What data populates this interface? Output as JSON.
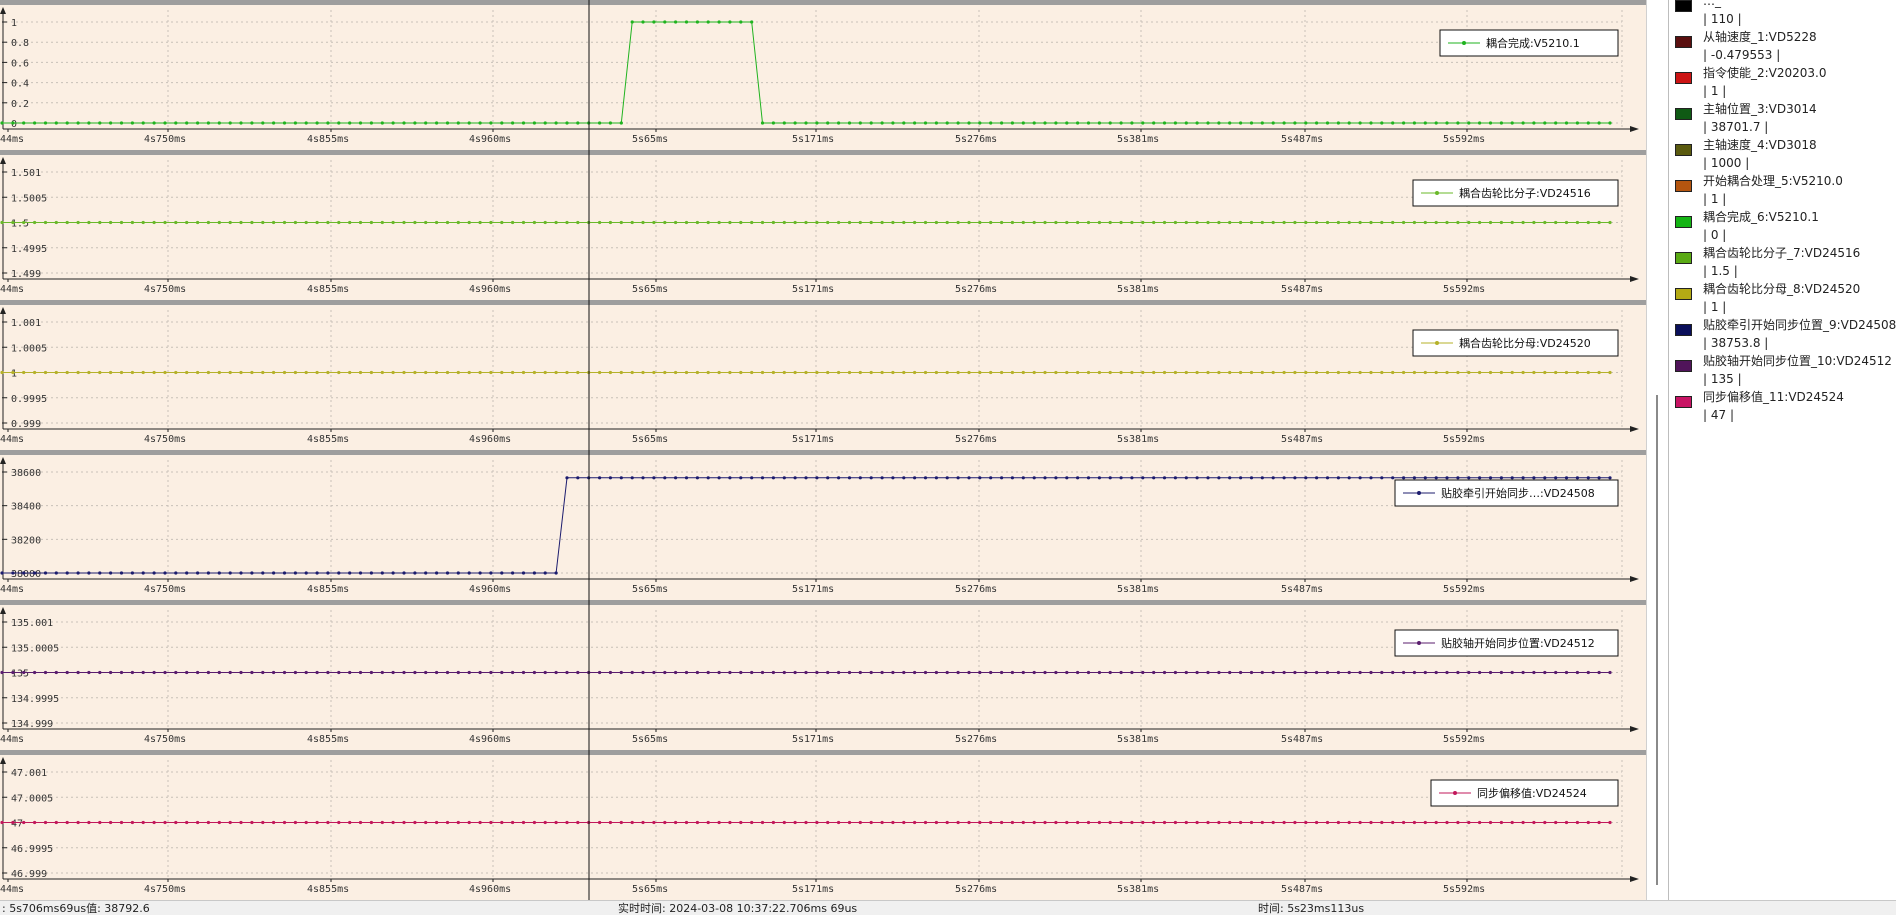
{
  "x_ticks": [
    "44ms",
    "4s750ms",
    "4s855ms",
    "4s960ms",
    "5s65ms",
    "5s171ms",
    "5s276ms",
    "5s381ms",
    "5s487ms",
    "5s592ms"
  ],
  "chart_data": [
    {
      "type": "line",
      "title": "",
      "series": [
        {
          "name": "耦合完成:V5210.1",
          "color": "#1fb31f"
        }
      ],
      "y_ticks": [
        "1",
        "0.8",
        "0.6",
        "0.4",
        "0.2",
        "0"
      ],
      "ylim": [
        0,
        1
      ],
      "steps": [
        {
          "from_point": 0,
          "to_point": 57,
          "y": 0
        },
        {
          "from_point": 58,
          "to_point": 69,
          "y": 1
        },
        {
          "from_point": 70,
          "to_point": 148,
          "y": 0
        }
      ],
      "points_count": 149,
      "grid": true,
      "legend_position": "top-right"
    },
    {
      "type": "line",
      "series": [
        {
          "name": "耦合齿轮比分子:VD24516",
          "color": "#6ab82a"
        }
      ],
      "y_ticks": [
        "1.501",
        "1.5005",
        "1.5",
        "1.4995",
        "1.499"
      ],
      "ylim": [
        1.499,
        1.501
      ],
      "constant_value": 1.5,
      "points_count": 149,
      "grid": true,
      "legend_position": "top-right"
    },
    {
      "type": "line",
      "series": [
        {
          "name": "耦合齿轮比分母:VD24520",
          "color": "#b5b12a"
        }
      ],
      "y_ticks": [
        "1.001",
        "1.0005",
        "1",
        "0.9995",
        "0.999"
      ],
      "ylim": [
        0.999,
        1.001
      ],
      "constant_value": 1,
      "points_count": 149,
      "grid": true,
      "legend_position": "top-right"
    },
    {
      "type": "line",
      "series": [
        {
          "name": "贴胶牵引开始同步…:VD24508",
          "color": "#1c1c6e"
        }
      ],
      "y_ticks": [
        "38600",
        "38400",
        "38200",
        "38000"
      ],
      "ylim": [
        38000,
        38800
      ],
      "steps": [
        {
          "from_point": 0,
          "to_point": 51,
          "y": 38000
        },
        {
          "from_point": 52,
          "to_point": 148,
          "y": 38753.8
        }
      ],
      "points_count": 149,
      "grid": true,
      "legend_position": "top-right"
    },
    {
      "type": "line",
      "series": [
        {
          "name": "贴胶轴开始同步位置:VD24512",
          "color": "#5a1d6e"
        }
      ],
      "y_ticks": [
        "135.001",
        "135.0005",
        "135",
        "134.9995",
        "134.999"
      ],
      "ylim": [
        134.999,
        135.001
      ],
      "constant_value": 135,
      "points_count": 149,
      "grid": true,
      "legend_position": "top-right"
    },
    {
      "type": "line",
      "series": [
        {
          "name": "同步偏移值:VD24524",
          "color": "#c2185b"
        }
      ],
      "y_ticks": [
        "47.001",
        "47.0005",
        "47",
        "46.9995",
        "46.999"
      ],
      "ylim": [
        46.999,
        47.001
      ],
      "constant_value": 47,
      "points_count": 149,
      "grid": true,
      "legend_position": "top-right"
    }
  ],
  "sidebar": {
    "items": [
      {
        "name": "…_",
        "value": "| 110 |",
        "color": "#000000"
      },
      {
        "name": "从轴速度_1:VD5228",
        "value": "| -0.479553 |",
        "color": "#5a0f0f"
      },
      {
        "name": "指令使能_2:V20203.0",
        "value": "| 1 |",
        "color": "#cc1414"
      },
      {
        "name": "主轴位置_3:VD3014",
        "value": "| 38701.7 |",
        "color": "#0f5a14"
      },
      {
        "name": "主轴速度_4:VD3018",
        "value": "| 1000 |",
        "color": "#5a5a0f"
      },
      {
        "name": "开始耦合处理_5:V5210.0",
        "value": "| 1 |",
        "color": "#b4550f"
      },
      {
        "name": "耦合完成_6:V5210.1",
        "value": "| 0 |",
        "color": "#14b414"
      },
      {
        "name": "耦合齿轮比分子_7:VD24516",
        "value": "| 1.5 |",
        "color": "#5aaa14"
      },
      {
        "name": "耦合齿轮比分母_8:VD24520",
        "value": "| 1 |",
        "color": "#b4aa14"
      },
      {
        "name": "贴胶牵引开始同步位置_9:VD24508",
        "value": "| 38753.8 |",
        "color": "#0a0f5a"
      },
      {
        "name": "贴胶轴开始同步位置_10:VD24512",
        "value": "| 135 |",
        "color": "#50145a"
      },
      {
        "name": "同步偏移值_11:VD24524",
        "value": "| 47 |",
        "color": "#c81464"
      }
    ]
  },
  "status": {
    "cursor": ": 5s706ms69us值: 38792.6",
    "realtime": "实时时间: 2024-03-08 10:37:22.706ms 69us",
    "time": "时间: 5s23ms113us"
  }
}
